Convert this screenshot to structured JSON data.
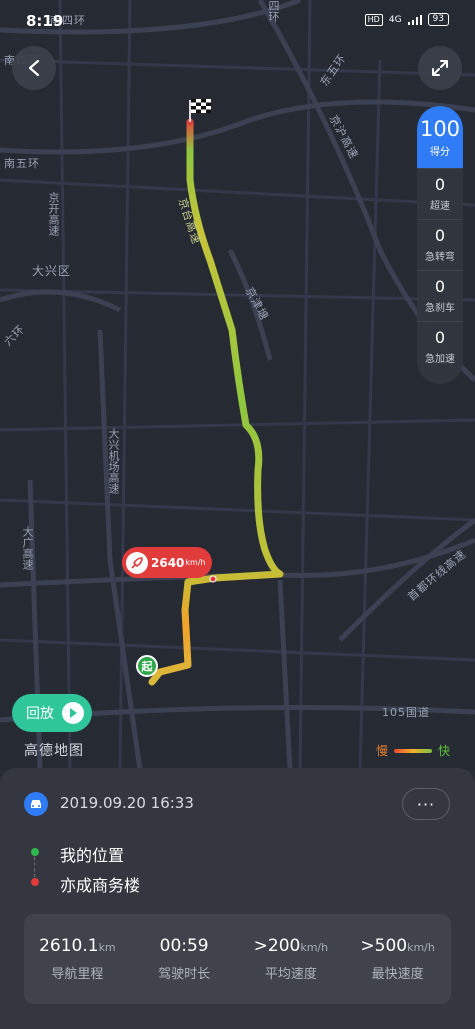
{
  "status_bar": {
    "time": "8:19",
    "hd": "HD",
    "network": "4G",
    "battery": "93"
  },
  "map": {
    "labels": {
      "nan_si_huan": "南四环",
      "nan_si_huan_top": "南四环",
      "si_huan_top": "四环",
      "dong_wu_huan": "东五环",
      "jing_hu_gao_su": "京沪高速",
      "nan_wu_huan": "南五环",
      "jing_kai_gao_su": "京开高速",
      "da_xing_qu": "大兴区",
      "liu_huan": "六环",
      "da_xing_ji_chang": "大兴机场高速",
      "da_guang_gao_su": "大广高速",
      "jing_tai_gao_su": "京台高速",
      "jing_jin_ta": "京津塘",
      "shou_du_huan_xian": "首都环线高速",
      "g105": "105国道"
    },
    "logo": "高德地图"
  },
  "score_panel": {
    "score": "100",
    "score_label": "得分",
    "metrics": [
      {
        "value": "0",
        "label": "超速"
      },
      {
        "value": "0",
        "label": "急转弯"
      },
      {
        "value": "0",
        "label": "急刹车"
      },
      {
        "value": "0",
        "label": "急加速"
      }
    ]
  },
  "speed_marker": {
    "value": "2640",
    "unit": "km/h"
  },
  "start_marker": "起",
  "replay": {
    "label": "回放"
  },
  "legend": {
    "slow": "慢",
    "fast": "快"
  },
  "trip": {
    "datetime": "2019.09.20 16:33",
    "more": "···",
    "start_location": "我的位置",
    "end_location": "亦成商务楼",
    "stats": [
      {
        "value": "2610.1",
        "unit": "km",
        "label": "导航里程"
      },
      {
        "value": "00:59",
        "unit": "",
        "label": "驾驶时长"
      },
      {
        "value": ">200",
        "unit": "km/h",
        "label": "平均速度"
      },
      {
        "value": ">500",
        "unit": "km/h",
        "label": "最快速度"
      }
    ]
  },
  "colors": {
    "accent_blue": "#2f7cf6",
    "replay_green": "#2fc79a",
    "alert_red": "#e23b3b",
    "route_green": "#7ac143",
    "route_orange": "#f2a22a"
  }
}
